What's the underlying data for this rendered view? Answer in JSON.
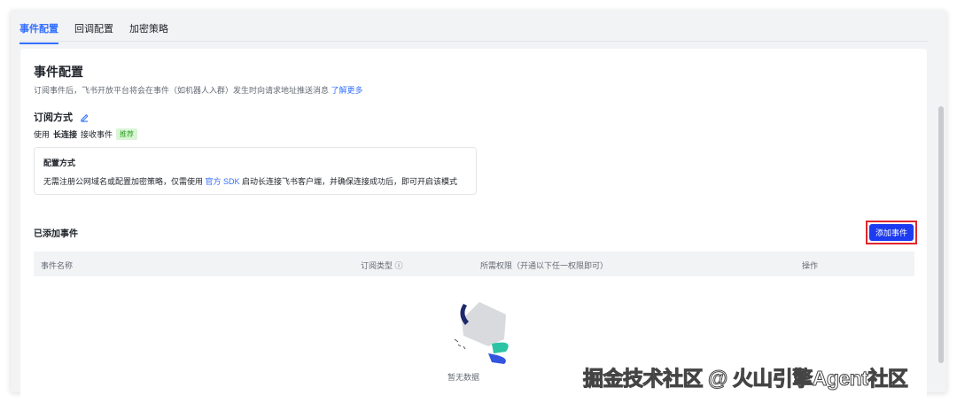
{
  "tabs": [
    "事件配置",
    "回调配置",
    "加密策略"
  ],
  "section": {
    "title": "事件配置",
    "description": "订阅事件后，飞书开放平台将会在事件（如机器人入群）发生时向请求地址推送消息 ",
    "learn_more": "了解更多"
  },
  "subscription": {
    "label": "订阅方式",
    "use_prefix": "使用",
    "mode": "长连接",
    "use_suffix": "接收事件",
    "tag": "推荐"
  },
  "config_box": {
    "title": "配置方式",
    "text_before": "无需注册公网域名或配置加密策略，仅需使用 ",
    "link": "官方 SDK",
    "text_after": " 启动长连接飞书客户端，并确保连接成功后，即可开启该模式"
  },
  "events": {
    "title": "已添加事件",
    "add_button": "添加事件",
    "columns": [
      "事件名称",
      "订阅类型 ⓘ",
      "所需权限（开通以下任一权限即可）",
      "操作"
    ],
    "empty_text": "暂无数据"
  },
  "watermark": "掘金技术社区 @ 火山引擎Agent社区"
}
